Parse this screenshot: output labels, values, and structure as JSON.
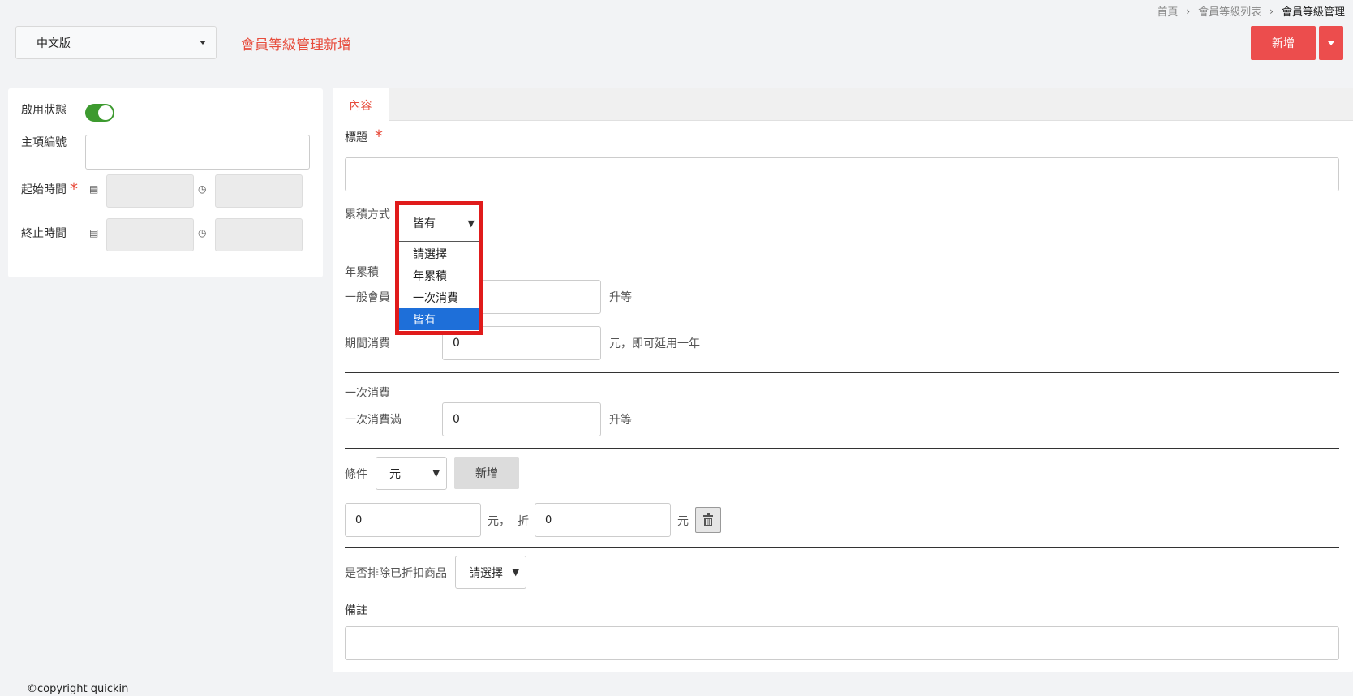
{
  "breadcrumb": {
    "home": "首頁",
    "list": "會員等級列表",
    "current": "會員等級管理"
  },
  "header": {
    "language": "中文版",
    "title": "會員等級管理新增",
    "add_button": "新增"
  },
  "left": {
    "status_label": "啟用狀態",
    "item_no_label": "主項編號",
    "start_label": "起始時間",
    "end_label": "終止時間"
  },
  "tabs": {
    "content": "內容"
  },
  "form": {
    "title_label": "標題",
    "accumulate_label": "累積方式",
    "accumulate_value": "皆有",
    "accumulate_options": [
      "請選擇",
      "年累積",
      "一次消費",
      "皆有"
    ],
    "year_section": "年累積",
    "normal_member_label": "一般會員",
    "normal_member_unit": "升等",
    "period_label": "期間消費",
    "period_value": "0",
    "period_unit": "元，即可延用一年",
    "once_section": "一次消費",
    "once_label": "一次消費滿",
    "once_value": "0",
    "once_unit": "升等",
    "condition_label": "條件",
    "condition_select": "元",
    "condition_add": "新增",
    "cond_amount": "0",
    "cond_amount_unit": "元，",
    "cond_discount_label": "折",
    "cond_discount": "0",
    "cond_discount_unit": "元",
    "exclude_label": "是否排除已折扣商品",
    "exclude_value": "請選擇",
    "note_label": "備註"
  },
  "footer": "©copyright quickin",
  "colors": {
    "accent": "#ec4d4d",
    "toggle": "#3d9a2f",
    "highlight": "#e01b1b",
    "selected": "#1e6fd9"
  }
}
